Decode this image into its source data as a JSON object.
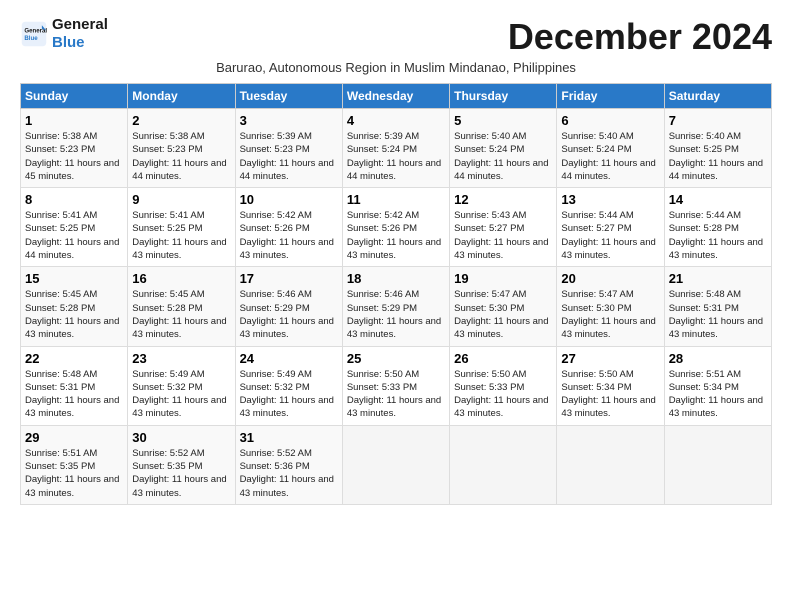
{
  "logo": {
    "line1": "General",
    "line2": "Blue"
  },
  "header": {
    "month_year": "December 2024",
    "location": "Barurao, Autonomous Region in Muslim Mindanao, Philippines"
  },
  "days_of_week": [
    "Sunday",
    "Monday",
    "Tuesday",
    "Wednesday",
    "Thursday",
    "Friday",
    "Saturday"
  ],
  "weeks": [
    [
      {
        "day": "1",
        "info": "Sunrise: 5:38 AM\nSunset: 5:23 PM\nDaylight: 11 hours and 45 minutes."
      },
      {
        "day": "2",
        "info": "Sunrise: 5:38 AM\nSunset: 5:23 PM\nDaylight: 11 hours and 44 minutes."
      },
      {
        "day": "3",
        "info": "Sunrise: 5:39 AM\nSunset: 5:23 PM\nDaylight: 11 hours and 44 minutes."
      },
      {
        "day": "4",
        "info": "Sunrise: 5:39 AM\nSunset: 5:24 PM\nDaylight: 11 hours and 44 minutes."
      },
      {
        "day": "5",
        "info": "Sunrise: 5:40 AM\nSunset: 5:24 PM\nDaylight: 11 hours and 44 minutes."
      },
      {
        "day": "6",
        "info": "Sunrise: 5:40 AM\nSunset: 5:24 PM\nDaylight: 11 hours and 44 minutes."
      },
      {
        "day": "7",
        "info": "Sunrise: 5:40 AM\nSunset: 5:25 PM\nDaylight: 11 hours and 44 minutes."
      }
    ],
    [
      {
        "day": "8",
        "info": "Sunrise: 5:41 AM\nSunset: 5:25 PM\nDaylight: 11 hours and 44 minutes."
      },
      {
        "day": "9",
        "info": "Sunrise: 5:41 AM\nSunset: 5:25 PM\nDaylight: 11 hours and 43 minutes."
      },
      {
        "day": "10",
        "info": "Sunrise: 5:42 AM\nSunset: 5:26 PM\nDaylight: 11 hours and 43 minutes."
      },
      {
        "day": "11",
        "info": "Sunrise: 5:42 AM\nSunset: 5:26 PM\nDaylight: 11 hours and 43 minutes."
      },
      {
        "day": "12",
        "info": "Sunrise: 5:43 AM\nSunset: 5:27 PM\nDaylight: 11 hours and 43 minutes."
      },
      {
        "day": "13",
        "info": "Sunrise: 5:44 AM\nSunset: 5:27 PM\nDaylight: 11 hours and 43 minutes."
      },
      {
        "day": "14",
        "info": "Sunrise: 5:44 AM\nSunset: 5:28 PM\nDaylight: 11 hours and 43 minutes."
      }
    ],
    [
      {
        "day": "15",
        "info": "Sunrise: 5:45 AM\nSunset: 5:28 PM\nDaylight: 11 hours and 43 minutes."
      },
      {
        "day": "16",
        "info": "Sunrise: 5:45 AM\nSunset: 5:28 PM\nDaylight: 11 hours and 43 minutes."
      },
      {
        "day": "17",
        "info": "Sunrise: 5:46 AM\nSunset: 5:29 PM\nDaylight: 11 hours and 43 minutes."
      },
      {
        "day": "18",
        "info": "Sunrise: 5:46 AM\nSunset: 5:29 PM\nDaylight: 11 hours and 43 minutes."
      },
      {
        "day": "19",
        "info": "Sunrise: 5:47 AM\nSunset: 5:30 PM\nDaylight: 11 hours and 43 minutes."
      },
      {
        "day": "20",
        "info": "Sunrise: 5:47 AM\nSunset: 5:30 PM\nDaylight: 11 hours and 43 minutes."
      },
      {
        "day": "21",
        "info": "Sunrise: 5:48 AM\nSunset: 5:31 PM\nDaylight: 11 hours and 43 minutes."
      }
    ],
    [
      {
        "day": "22",
        "info": "Sunrise: 5:48 AM\nSunset: 5:31 PM\nDaylight: 11 hours and 43 minutes."
      },
      {
        "day": "23",
        "info": "Sunrise: 5:49 AM\nSunset: 5:32 PM\nDaylight: 11 hours and 43 minutes."
      },
      {
        "day": "24",
        "info": "Sunrise: 5:49 AM\nSunset: 5:32 PM\nDaylight: 11 hours and 43 minutes."
      },
      {
        "day": "25",
        "info": "Sunrise: 5:50 AM\nSunset: 5:33 PM\nDaylight: 11 hours and 43 minutes."
      },
      {
        "day": "26",
        "info": "Sunrise: 5:50 AM\nSunset: 5:33 PM\nDaylight: 11 hours and 43 minutes."
      },
      {
        "day": "27",
        "info": "Sunrise: 5:50 AM\nSunset: 5:34 PM\nDaylight: 11 hours and 43 minutes."
      },
      {
        "day": "28",
        "info": "Sunrise: 5:51 AM\nSunset: 5:34 PM\nDaylight: 11 hours and 43 minutes."
      }
    ],
    [
      {
        "day": "29",
        "info": "Sunrise: 5:51 AM\nSunset: 5:35 PM\nDaylight: 11 hours and 43 minutes."
      },
      {
        "day": "30",
        "info": "Sunrise: 5:52 AM\nSunset: 5:35 PM\nDaylight: 11 hours and 43 minutes."
      },
      {
        "day": "31",
        "info": "Sunrise: 5:52 AM\nSunset: 5:36 PM\nDaylight: 11 hours and 43 minutes."
      },
      {
        "day": "",
        "info": ""
      },
      {
        "day": "",
        "info": ""
      },
      {
        "day": "",
        "info": ""
      },
      {
        "day": "",
        "info": ""
      }
    ]
  ]
}
